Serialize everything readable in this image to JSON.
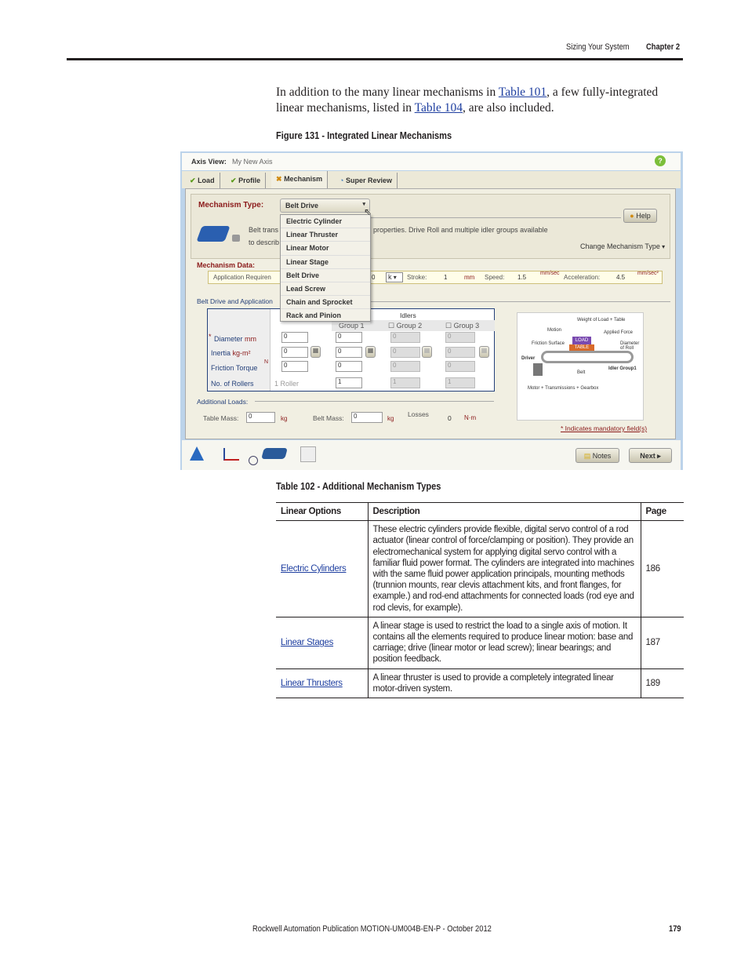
{
  "header": {
    "section": "Sizing Your System",
    "chapter": "Chapter 2"
  },
  "intro": {
    "p1": "In addition to the many linear mechanisms in ",
    "link1": "Table 101",
    "p2": ", a few fully-integrated linear mechanisms, listed in ",
    "link2": "Table 104",
    "p3": ", are also included."
  },
  "figure_caption": "Figure 131 - Integrated Linear Mechanisms",
  "app": {
    "title_label": "Axis View:",
    "title_value": "My New Axis",
    "tabs": [
      {
        "label": "Load",
        "icon": "check-icon"
      },
      {
        "label": "Profile",
        "icon": "check-icon"
      },
      {
        "label": "Mechanism",
        "icon": "x-icon"
      },
      {
        "label": "Super Review",
        "icon": "gauge-icon"
      }
    ],
    "mechanism_type_label": "Mechanism Type:",
    "mechanism_type_value": "Belt Drive",
    "dropdown_options": [
      "Electric Cylinder",
      "Linear Thruster",
      "Linear Motor",
      "Linear Stage",
      "Belt Drive",
      "Lead Screw",
      "Chain and Sprocket",
      "Rack and Pinion"
    ],
    "help_label": "Help",
    "desc_line1_start": "Belt trans",
    "desc_line2_start": "to describ",
    "desc_line1_end": "properties.  Drive Roll and multiple idler groups available",
    "change_type": "Change Mechanism Type",
    "mech_data_label": "Mechanism Data:",
    "app_req": {
      "label": "Application Requiren",
      "value": "0",
      "unit": "k",
      "stroke_label": "Stroke:",
      "stroke": "1",
      "stroke_unit": "mm",
      "speed_label": "Speed:",
      "speed": "1.5",
      "speed_unit": "mm/sec",
      "accel_label": "Acceleration:",
      "accel": "4.5",
      "accel_unit": "mm/sec²"
    },
    "section_label": "Belt Drive and Application",
    "grid": {
      "idlers": "Idlers",
      "groups": [
        "Group 1",
        "Group 2",
        "Group 3"
      ],
      "rows": [
        {
          "label": "Diameter",
          "unit": "mm",
          "mandatory": "*",
          "vals": [
            "0",
            "0",
            "0",
            "0"
          ]
        },
        {
          "label": "Inertia",
          "unit": "kg-m²",
          "vals": [
            "0",
            "0",
            "0",
            "0"
          ]
        },
        {
          "label": "Friction Torque",
          "unit": "N",
          "vals": [
            "0",
            "0",
            "0",
            "0"
          ]
        },
        {
          "label": "No. of Rollers",
          "first": "1 Roller",
          "vals": [
            "1",
            "1",
            "1"
          ]
        }
      ]
    },
    "additional_loads": "Additional Loads:",
    "table_mass_label": "Table Mass:",
    "table_mass": "0",
    "kg": "kg",
    "belt_mass_label": "Belt Mass:",
    "belt_mass": "0",
    "losses_label": "Losses",
    "losses": "0",
    "losses_unit": "N·m",
    "mandatory_note": "* Indicates mandatory field(s)",
    "diagram": {
      "weight": "Weight of Load + Table",
      "motion": "Motion",
      "applied": "Applied Force",
      "friction": "Friction Surface",
      "load": "LOAD",
      "table": "TABLE",
      "diameter": "Diameter of Roll",
      "driver": "Driver",
      "idler": "Idler Group1",
      "belt": "Belt",
      "motor": "Motor + Transmissions + Gearbox"
    },
    "notes_label": "Notes",
    "next_label": "Next"
  },
  "table_caption": "Table 102 - Additional Mechanism Types",
  "table": {
    "headers": [
      "Linear Options",
      "Description",
      "Page"
    ],
    "rows": [
      {
        "option": "Electric Cylinders",
        "desc": "These electric cylinders provide flexible, digital servo control of a rod actuator (linear control of force/clamping or position). They provide an electromechanical system for applying digital servo control with a familiar fluid power format. The cylinders are integrated into machines with the same fluid power application principals, mounting methods (trunnion mounts, rear clevis attachment kits, and front flanges, for example.) and rod-end attachments for connected loads (rod eye and rod clevis, for example).",
        "page": "186"
      },
      {
        "option": "Linear Stages",
        "desc": "A linear stage is used to restrict the load to a single axis of motion. It contains all the elements required to produce linear motion: base and carriage; drive (linear motor or lead screw); linear bearings; and position feedback.",
        "page": "187"
      },
      {
        "option": "Linear Thrusters",
        "desc": "A linear thruster is used to provide a completely integrated linear motor-driven system.",
        "page": "189"
      }
    ]
  },
  "footer": {
    "publication": "Rockwell Automation Publication MOTION-UM004B-EN-P - October 2012",
    "page": "179"
  }
}
